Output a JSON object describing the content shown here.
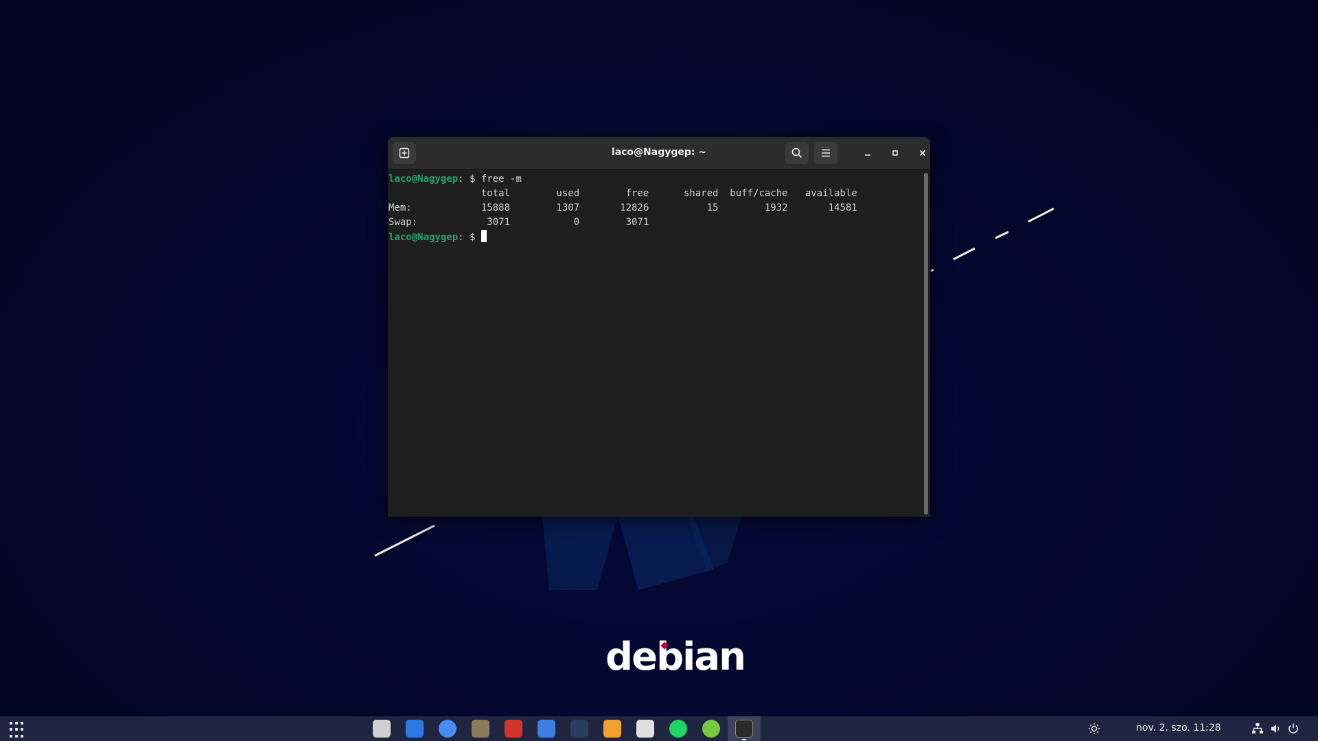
{
  "desktop": {
    "logo_text": "debian"
  },
  "terminal": {
    "title": "laco@Nagygep: ~",
    "prompt_user": "laco@Nagygep",
    "prompt_suffix": ": $ ",
    "command": "free -m",
    "header_line": "                total        used        free      shared  buff/cache   available",
    "mem_line": "Mem:            15888        1307       12826          15        1932       14581",
    "swap_line": "Swap:            3071           0        3071",
    "table": {
      "columns": [
        "total",
        "used",
        "free",
        "shared",
        "buff/cache",
        "available"
      ],
      "rows": [
        {
          "label": "Mem:",
          "values": [
            "15888",
            "1307",
            "12826",
            "15",
            "1932",
            "14581"
          ]
        },
        {
          "label": "Swap:",
          "values": [
            "3071",
            "0",
            "3071"
          ]
        }
      ]
    },
    "icons": {
      "new_tab": "new-tab-icon",
      "search": "search-icon",
      "menu": "hamburger-menu-icon",
      "minimize": "minimize-icon",
      "maximize": "maximize-icon",
      "close": "close-icon"
    }
  },
  "taskbar": {
    "apps_icon": "apps-grid-icon",
    "dock": [
      {
        "name": "timeshift-icon",
        "color": "#d0d0d0"
      },
      {
        "name": "libreoffice-writer-icon",
        "color": "#2a7ae2"
      },
      {
        "name": "chromium-icon",
        "color": "#4a8cf7"
      },
      {
        "name": "gimp-icon",
        "color": "#8a7a5a"
      },
      {
        "name": "doublecmd-icon",
        "color": "#d0352b"
      },
      {
        "name": "text-editor-icon",
        "color": "#3d7fe0"
      },
      {
        "name": "davinci-resolve-icon",
        "color": "#2b3c5c"
      },
      {
        "name": "sync-icon",
        "color": "#f0a030"
      },
      {
        "name": "calculator-icon",
        "color": "#e0e0e0"
      },
      {
        "name": "spotify-icon",
        "color": "#1ed760"
      },
      {
        "name": "cloud-sync-icon",
        "color": "#7ac943"
      },
      {
        "name": "terminal-icon",
        "color": "#2a2a2a",
        "active": true
      }
    ],
    "clock": "nov. 2. szo.  11:28",
    "tray_icons": [
      "brightness-icon",
      "network-icon",
      "volume-icon",
      "power-icon"
    ]
  }
}
